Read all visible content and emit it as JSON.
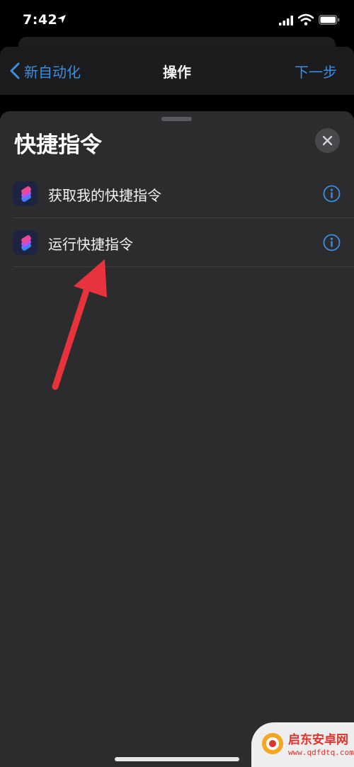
{
  "status_bar": {
    "time": "7:42"
  },
  "nav": {
    "back_label": "新自动化",
    "title": "操作",
    "next_label": "下一步"
  },
  "sheet": {
    "title": "快捷指令",
    "items": [
      {
        "label": "获取我的快捷指令",
        "icon": "shortcuts-app-icon"
      },
      {
        "label": "运行快捷指令",
        "icon": "shortcuts-app-icon"
      }
    ]
  },
  "watermark": {
    "title": "启东安卓网",
    "url": "www.qdfdtq.com"
  },
  "colors": {
    "accent": "#3a8ee6",
    "sheet_bg": "#2c2c2e",
    "arrow": "#e8323c"
  }
}
